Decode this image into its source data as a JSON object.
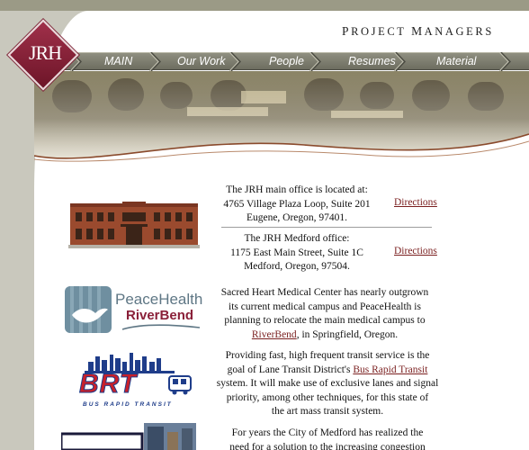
{
  "header": {
    "tagline_p": "P",
    "tagline_roject": "ROJECT",
    "tagline_m": "M",
    "tagline_anagers": "ANAGERS",
    "logo_text": "JRH"
  },
  "nav": {
    "items": [
      {
        "label": "MAIN"
      },
      {
        "label": "Our Work"
      },
      {
        "label": "People"
      },
      {
        "label": "Resumes"
      },
      {
        "label": "Material"
      }
    ]
  },
  "offices": {
    "main": {
      "line1": "The JRH main office is located at:",
      "line2": "4765 Village Plaza Loop, Suite 201",
      "line3": "Eugene, Oregon, 97401.",
      "directions": "Directions"
    },
    "medford": {
      "line1": "The JRH Medford office:",
      "line2": "1175 East Main Street, Suite 1C",
      "line3": "Medford, Oregon, 97504.",
      "directions": "Directions"
    }
  },
  "projects": {
    "peacehealth": {
      "logo_name": "PeaceHealth",
      "logo_sub": "RiverBend",
      "line1": "Sacred Heart Medical Center has nearly outgrown",
      "line2": "its current medical campus and PeaceHealth is",
      "line3": "planning to relocate the main medical campus to",
      "link": "RiverBend",
      "line4_rest": ", in Springfield, Oregon."
    },
    "brt": {
      "logo_text": "BRT",
      "logo_sub": "BUS RAPID TRANSIT",
      "line1": "Providing fast, high frequent transit service is the",
      "line2_pre": "goal of Lane Transit District's ",
      "link": "Bus Rapid Transit",
      "line3": "system. It will make use of exclusive lanes and signal",
      "line4": "priority, among other techniques, for this state of",
      "line5": "the art mass transit system."
    },
    "medford": {
      "line1": "For years the City of Medford has realized the",
      "line2": "need for a solution to the increasing congestion"
    }
  },
  "colors": {
    "accent": "#7a1f1f",
    "nav_bg": "#7d7d6f",
    "logo": "#8a2039",
    "sidebar": "#c9c8bd"
  }
}
